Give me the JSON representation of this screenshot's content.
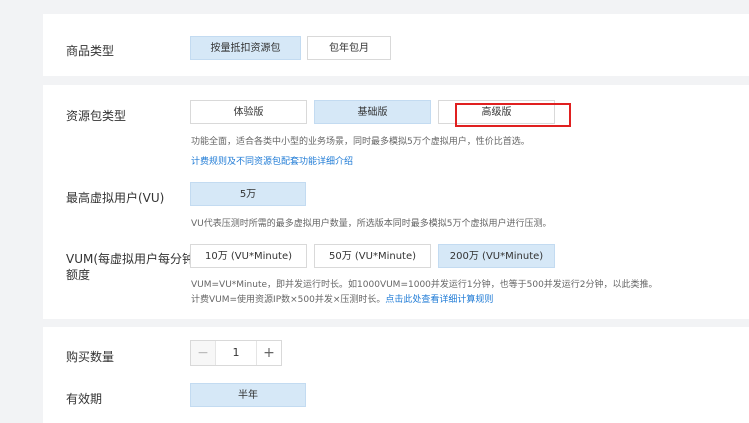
{
  "product_type": {
    "label": "商品类型",
    "options": [
      "按量抵扣资源包",
      "包年包月"
    ]
  },
  "package_type": {
    "label": "资源包类型",
    "options": [
      "体验版",
      "基础版",
      "高级版"
    ],
    "desc": "功能全面，适合各类中小型的业务场景，同时最多模拟5万个虚拟用户，性价比首选。",
    "link": "计费规则及不同资源包配套功能详细介绍"
  },
  "max_users": {
    "label": "最高虚拟用户(VU)",
    "value": "5万",
    "desc": "VU代表压测时所需的最多虚拟用户数量，所选版本同时最多模拟5万个虚拟用户进行压测。"
  },
  "vum": {
    "label_line1": "VUM(每虚拟用户每分钟)",
    "label_line2": "额度",
    "options": [
      "10万 (VU*Minute)",
      "50万 (VU*Minute)",
      "200万 (VU*Minute)"
    ],
    "desc1": "VUM=VU*Minute，即并发运行时长。如1000VUM=1000并发运行1分钟，也等于500并发运行2分钟，以此类推。",
    "desc2": "计费VUM=使用资源IP数×500并发×压测时长。",
    "desc2_link": "点击此处查看详细计算规则"
  },
  "quantity": {
    "label": "购买数量",
    "value": "1",
    "minus": "−",
    "plus": "+"
  },
  "validity": {
    "label": "有效期",
    "value": "半年"
  },
  "colors": {
    "accent": "#1f7bd6",
    "selected_bg": "#d6e8f7",
    "highlight": "#e02020"
  }
}
